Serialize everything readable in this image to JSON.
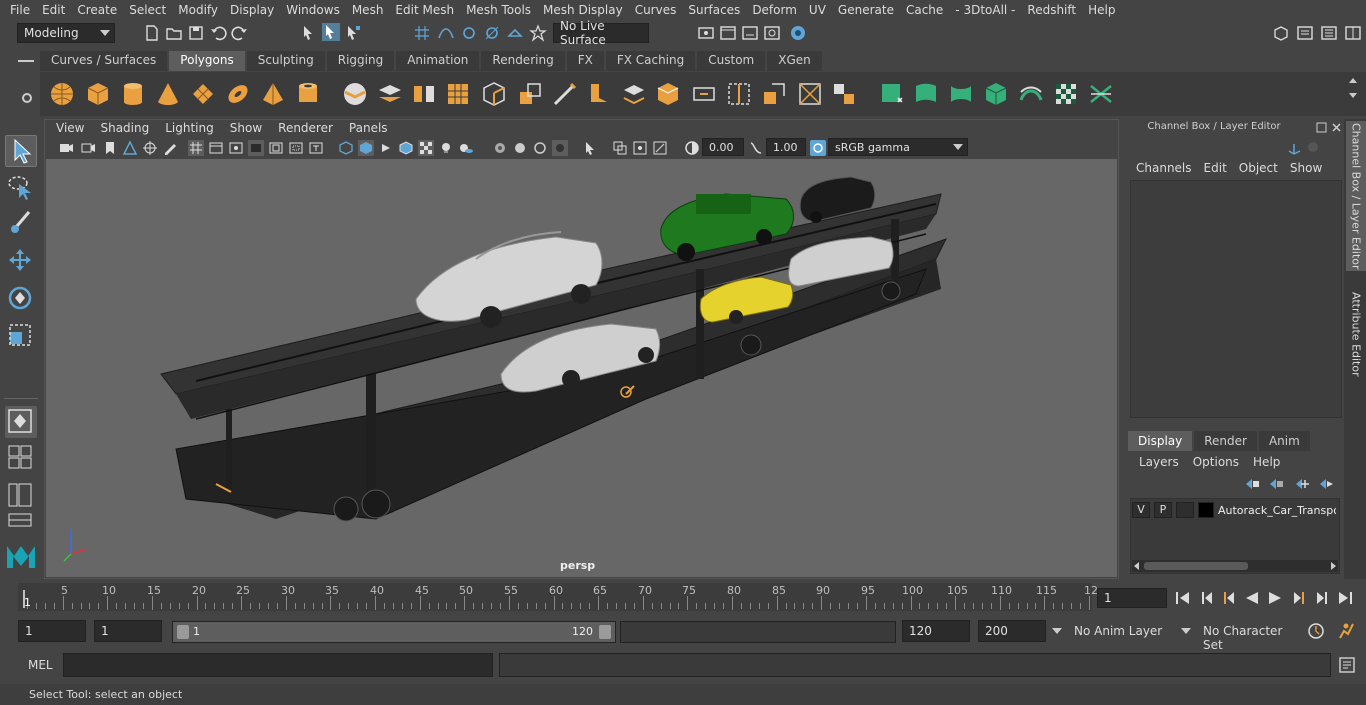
{
  "menubar": [
    "File",
    "Edit",
    "Create",
    "Select",
    "Modify",
    "Display",
    "Windows",
    "Mesh",
    "Edit Mesh",
    "Mesh Tools",
    "Mesh Display",
    "Curves",
    "Surfaces",
    "Deform",
    "UV",
    "Generate",
    "Cache",
    "- 3DtoAll -",
    "Redshift",
    "Help"
  ],
  "status": {
    "mode": "Modeling",
    "live_surface": "No Live Surface"
  },
  "shelf_tabs": [
    "Curves / Surfaces",
    "Polygons",
    "Sculpting",
    "Rigging",
    "Animation",
    "Rendering",
    "FX",
    "FX Caching",
    "Custom",
    "XGen"
  ],
  "shelf_active": "Polygons",
  "viewport": {
    "menu": [
      "View",
      "Shading",
      "Lighting",
      "Show",
      "Renderer",
      "Panels"
    ],
    "exposure": "0.00",
    "gamma": "1.00",
    "color_space": "sRGB gamma",
    "camera_label": "persp"
  },
  "channel_box": {
    "title": "Channel Box / Layer Editor",
    "menu": [
      "Channels",
      "Edit",
      "Object",
      "Show"
    ]
  },
  "layer_editor": {
    "tabs": [
      "Display",
      "Render",
      "Anim"
    ],
    "active_tab": "Display",
    "menu": [
      "Layers",
      "Options",
      "Help"
    ],
    "layer": {
      "v": "V",
      "p": "P",
      "name": "Autorack_Car_Transpo"
    }
  },
  "side_tabs": [
    "Channel Box / Layer Editor",
    "Attribute Editor"
  ],
  "timeline": {
    "ticks": [
      "5",
      "10",
      "15",
      "20",
      "25",
      "30",
      "35",
      "40",
      "45",
      "50",
      "55",
      "60",
      "65",
      "70",
      "75",
      "80",
      "85",
      "90",
      "95",
      "100",
      "105",
      "110",
      "115",
      "12"
    ],
    "start_marker": "1",
    "current_frame": "1"
  },
  "range": {
    "start": "1",
    "playback_start": "1",
    "bar_start": "1",
    "bar_end": "120",
    "playback_end": "120",
    "end": "200",
    "anim_layer": "No Anim Layer",
    "char_set": "No Character Set"
  },
  "command": {
    "label": "MEL"
  },
  "help_line": "Select Tool: select an object",
  "colors": {
    "accent": "#5fa6d6",
    "maya_teal": "#19a4b4",
    "shelf_orange": "#e8a040",
    "shelf_green": "#36b07a"
  }
}
